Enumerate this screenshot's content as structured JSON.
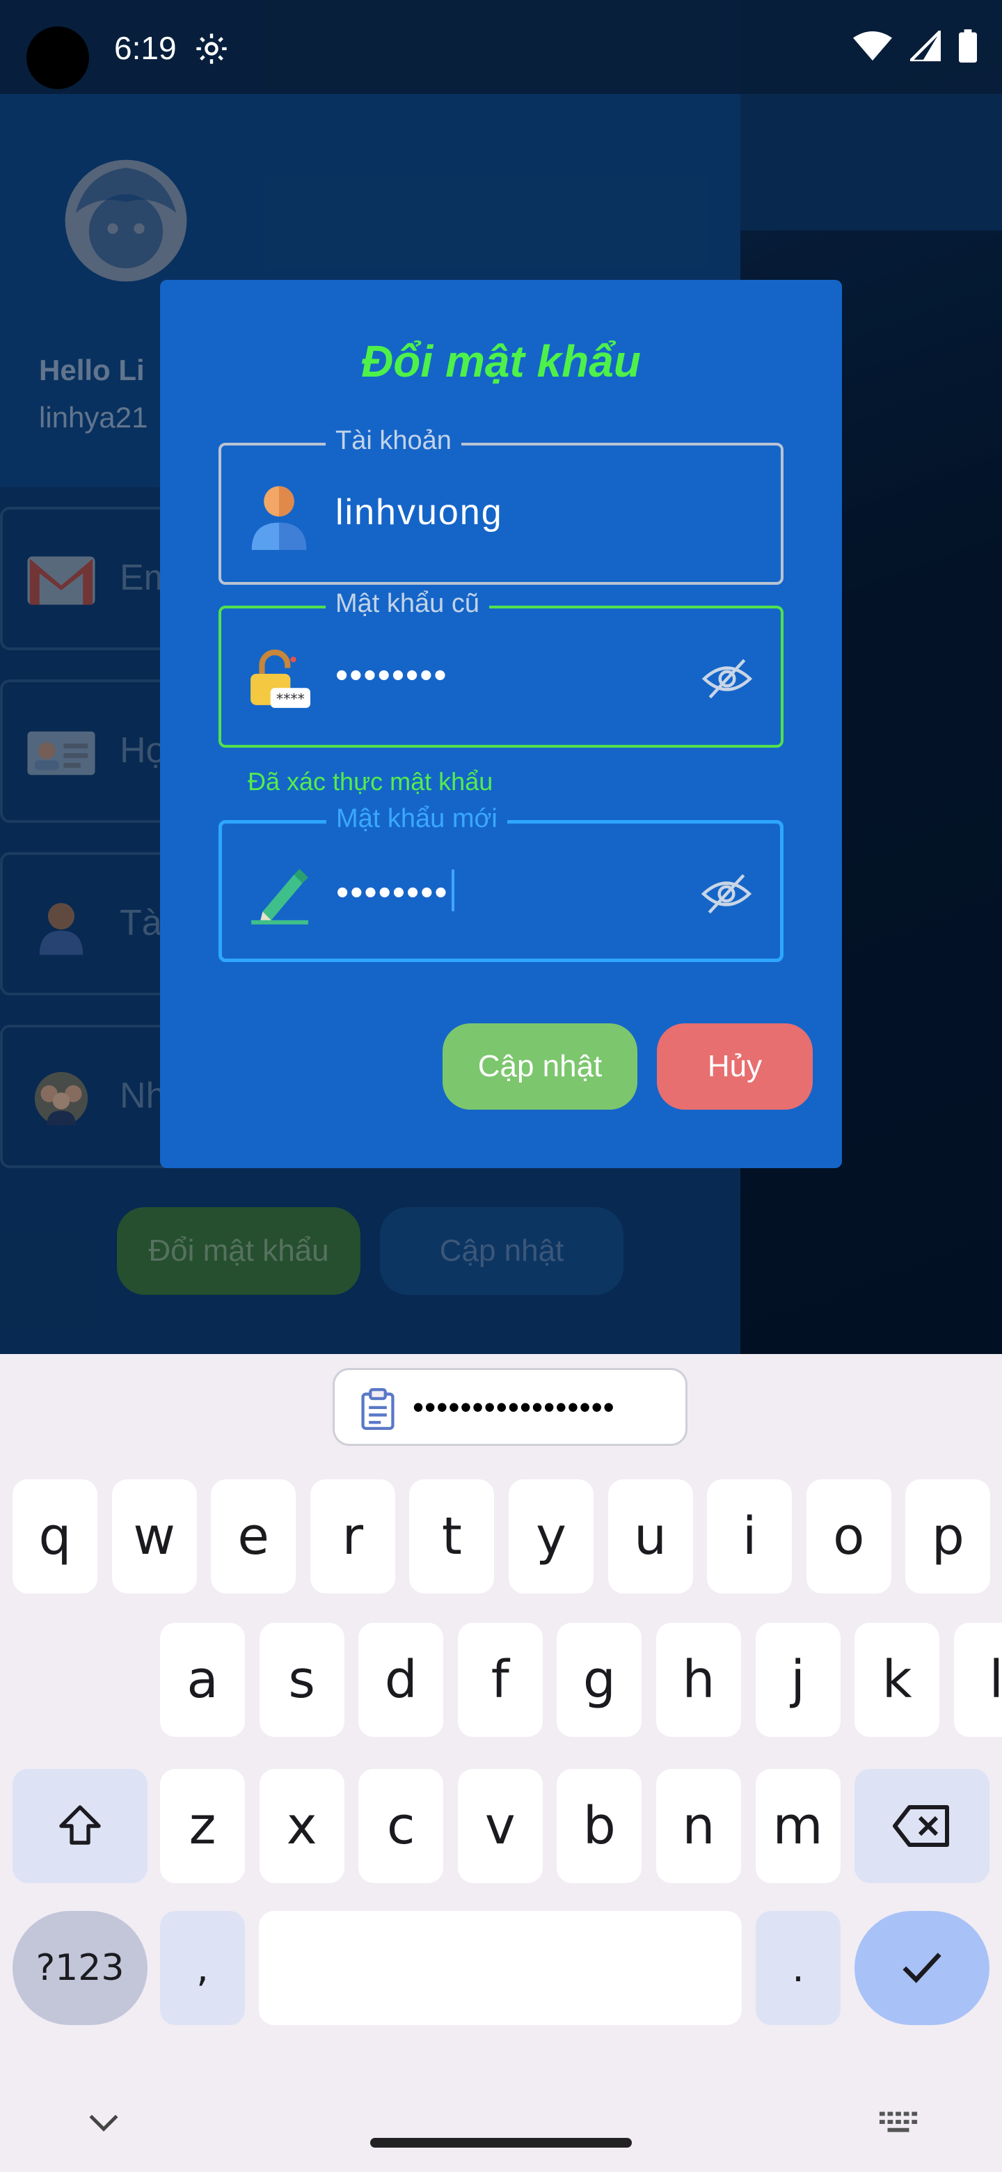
{
  "status_bar": {
    "time": "6:19",
    "icons": [
      "settings-gear-icon",
      "wifi-icon",
      "cellular-signal-icon",
      "battery-icon"
    ]
  },
  "background": {
    "hello_text": "Hello Li",
    "email_text": "linhya21",
    "rows": [
      {
        "icon": "gmail-icon",
        "label": "Em"
      },
      {
        "icon": "id-card-icon",
        "label": "Họ"
      },
      {
        "icon": "user-icon",
        "label": "Tà"
      },
      {
        "icon": "group-icon",
        "label": "Nh"
      }
    ],
    "change_password_button": "Đổi mật khẩu",
    "update_button": "Cập nhật"
  },
  "dialog": {
    "title": "Đổi mật khẩu",
    "account": {
      "label": "Tài khoản",
      "value": "linhvuong",
      "icon": "user-icon"
    },
    "old_password": {
      "label": "Mật khẩu cũ",
      "value": "••••••••",
      "icon": "lock-icon",
      "toggle_icon": "eye-off-icon"
    },
    "verified_hint": "Đã xác thực mật khẩu",
    "new_password": {
      "label": "Mật khẩu mới",
      "value": "••••••••",
      "icon": "pencil-icon",
      "toggle_icon": "eye-off-icon"
    },
    "update_button": "Cập nhật",
    "cancel_button": "Hủy"
  },
  "keyboard": {
    "clipboard_suggestion": "•••••••••••••••••",
    "row1": [
      "q",
      "w",
      "e",
      "r",
      "t",
      "y",
      "u",
      "i",
      "o",
      "p"
    ],
    "row2": [
      "a",
      "s",
      "d",
      "f",
      "g",
      "h",
      "j",
      "k",
      "l"
    ],
    "row3": [
      "z",
      "x",
      "c",
      "v",
      "b",
      "n",
      "m"
    ],
    "symbols_key": "?123",
    "comma_key": ",",
    "period_key": "."
  },
  "colors": {
    "dialog_bg": "#1565c8",
    "title_green": "#4ef14a",
    "verified_border": "#52e04e",
    "focused_border": "#2ea6ff",
    "update_button": "#7cc66e",
    "cancel_button": "#e86f6f"
  }
}
